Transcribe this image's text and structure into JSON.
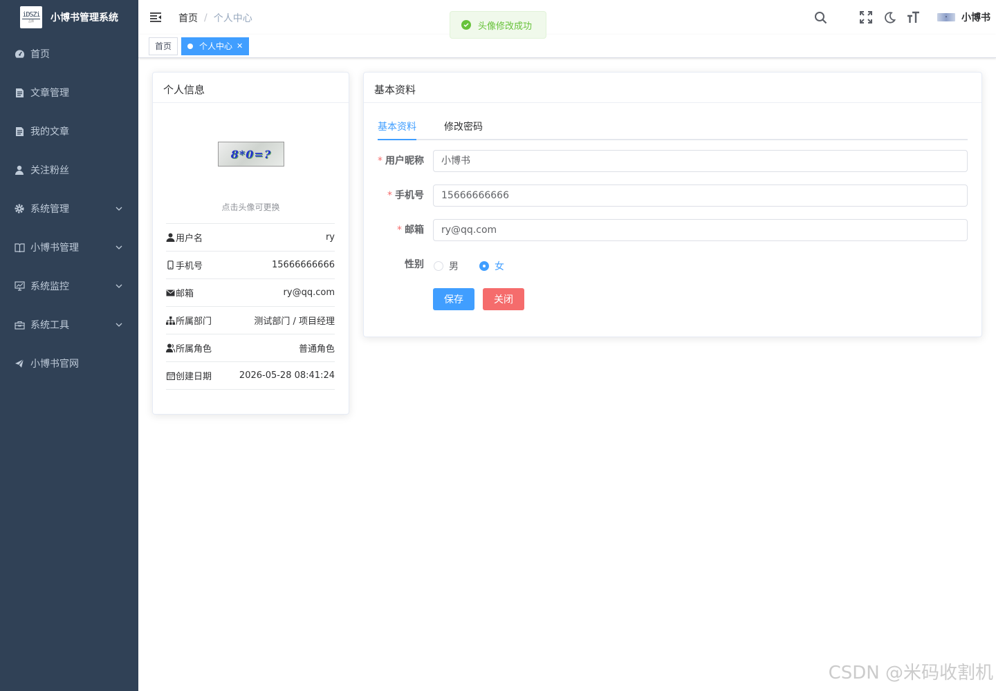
{
  "app": {
    "title": "小博书管理系统",
    "logo_line1": "iDSZi",
    "logo_line2": "品牌"
  },
  "sidebar": {
    "items": [
      {
        "label": "首页",
        "icon": "dashboard-icon"
      },
      {
        "label": "文章管理",
        "icon": "document-icon"
      },
      {
        "label": "我的文章",
        "icon": "document-icon"
      },
      {
        "label": "关注粉丝",
        "icon": "user-icon"
      },
      {
        "label": "系统管理",
        "icon": "gear-icon",
        "expandable": true
      },
      {
        "label": "小博书管理",
        "icon": "book-icon",
        "expandable": true
      },
      {
        "label": "系统监控",
        "icon": "monitor-icon",
        "expandable": true
      },
      {
        "label": "系统工具",
        "icon": "toolbox-icon",
        "expandable": true
      },
      {
        "label": "小博书官网",
        "icon": "send-icon"
      }
    ]
  },
  "header": {
    "breadcrumb": {
      "home": "首页",
      "separator": "/",
      "current": "个人中心"
    },
    "user_name": "小博书"
  },
  "tags": {
    "home": "首页",
    "current": "个人中心"
  },
  "toast": {
    "message": "头像修改成功"
  },
  "profile_card": {
    "title": "个人信息",
    "avatar_text": "8*0=?",
    "avatar_hint": "点击头像可更换",
    "rows": [
      {
        "label": "用户名",
        "value": "ry",
        "icon": "user-icon"
      },
      {
        "label": "手机号",
        "value": "15666666666",
        "icon": "phone-icon"
      },
      {
        "label": "邮箱",
        "value": "ry@qq.com",
        "icon": "mail-icon"
      },
      {
        "label": "所属部门",
        "value": "测试部门 / 项目经理",
        "icon": "tree-icon"
      },
      {
        "label": "所属角色",
        "value": "普通角色",
        "icon": "peoples-icon"
      },
      {
        "label": "创建日期",
        "value": "2026-05-28 08:41:24",
        "icon": "date-icon"
      }
    ]
  },
  "basic_card": {
    "title": "基本资料",
    "tabs": [
      {
        "label": "基本资料"
      },
      {
        "label": "修改密码"
      }
    ],
    "form": {
      "nickname_label": "用户昵称",
      "nickname_value": "小博书",
      "phone_label": "手机号",
      "phone_value": "15666666666",
      "email_label": "邮箱",
      "email_value": "ry@qq.com",
      "gender_label": "性别",
      "gender_male": "男",
      "gender_female": "女",
      "gender_selected": "女",
      "save_label": "保存",
      "close_label": "关闭"
    }
  },
  "watermark": "CSDN @米码收割机",
  "colors": {
    "sidebar": "#304156",
    "primary": "#409eff",
    "danger": "#f56c6c",
    "success": "#67c23a"
  }
}
